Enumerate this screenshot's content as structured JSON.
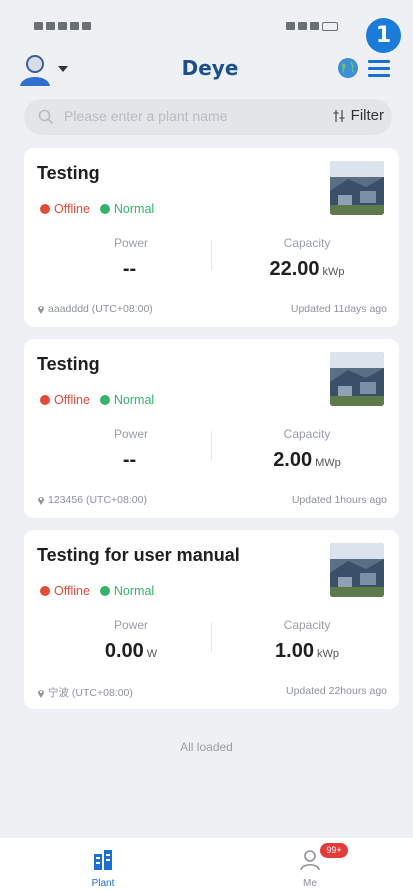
{
  "status_bar": {
    "marker_number": "1"
  },
  "header": {
    "brand": "Deye"
  },
  "search": {
    "placeholder": "Please enter a plant name",
    "filter_label": "Filter"
  },
  "plants": [
    {
      "name": "Testing",
      "status_offline": "Offline",
      "status_normal": "Normal",
      "power_label": "Power",
      "power_value": "--",
      "power_unit": "",
      "capacity_label": "Capacity",
      "capacity_value": "22.00",
      "capacity_unit": "kWp",
      "location": "aaadddd (UTC+08:00)",
      "updated": "Updated 11days ago"
    },
    {
      "name": "Testing",
      "status_offline": "Offline",
      "status_normal": "Normal",
      "power_label": "Power",
      "power_value": "--",
      "power_unit": "",
      "capacity_label": "Capacity",
      "capacity_value": "2.00",
      "capacity_unit": "MWp",
      "location": "123456 (UTC+08:00)",
      "updated": "Updated 1hours ago"
    },
    {
      "name": "Testing for user manual",
      "status_offline": "Offline",
      "status_normal": "Normal",
      "power_label": "Power",
      "power_value": "0.00",
      "power_unit": "W",
      "capacity_label": "Capacity",
      "capacity_value": "1.00",
      "capacity_unit": "kWp",
      "location": "宁波 (UTC+08:00)",
      "updated": "Updated 22hours ago"
    }
  ],
  "list_footer": "All loaded",
  "tabs": {
    "plant_label": "Plant",
    "me_label": "Me",
    "me_badge": "99+"
  },
  "colors": {
    "accent": "#1b6fd0",
    "offline": "#e04b3a",
    "normal": "#34b36a",
    "brand": "#1d4f8f"
  }
}
